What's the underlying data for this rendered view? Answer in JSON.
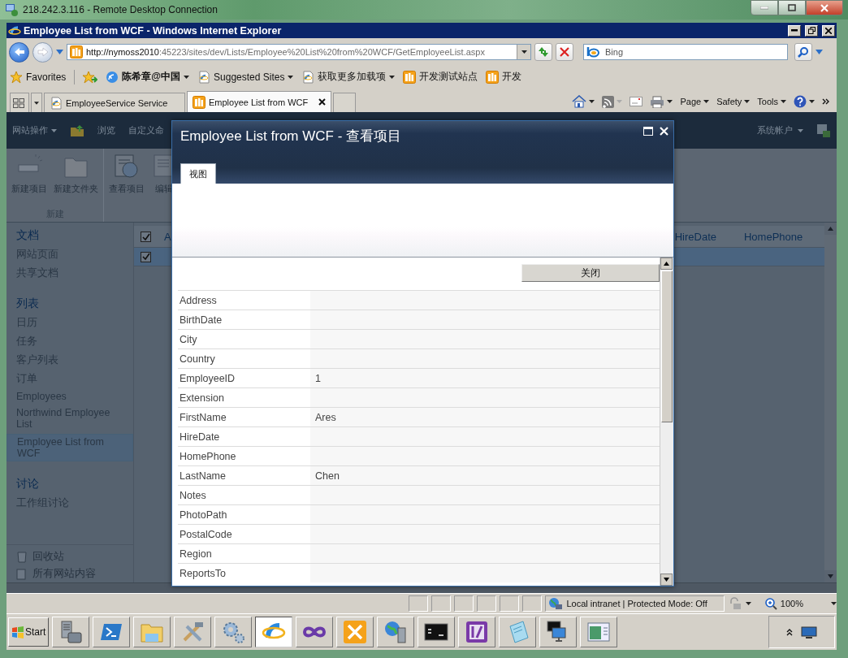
{
  "rdp_window": {
    "title": "218.242.3.116 - Remote Desktop Connection"
  },
  "browser": {
    "title": "Employee List from WCF - Windows Internet Explorer",
    "address": {
      "host": "http://nymoss2010",
      "rest": ":45223/sites/dev/Lists/Employee%20List%20from%20WCF/GetEmployeeList.aspx"
    },
    "search": {
      "placeholder": "Bing"
    },
    "favorites": {
      "label": "Favorites",
      "items": [
        {
          "label": "陈希章@中国",
          "kind": "feed",
          "menu": true
        },
        {
          "label": "Suggested Sites",
          "kind": "page",
          "menu": true
        },
        {
          "label": "获取更多加载项",
          "kind": "page",
          "menu": true
        },
        {
          "label": "开发测试站点",
          "kind": "site",
          "menu": false
        },
        {
          "label": "开发",
          "kind": "site",
          "menu": false
        }
      ]
    },
    "tabs": [
      {
        "label": "EmployeeService Service",
        "kind": "page",
        "selected": false
      },
      {
        "label": "Employee List from WCF",
        "kind": "site",
        "selected": true
      }
    ],
    "commands": [
      {
        "label": "Page"
      },
      {
        "label": "Safety"
      },
      {
        "label": "Tools"
      }
    ]
  },
  "sharepoint": {
    "top_nav": [
      {
        "label": "网站操作",
        "menu": true
      },
      {
        "label": "浏览",
        "menu": false
      },
      {
        "label": "自定义命",
        "menu": false
      }
    ],
    "account": "系统帐户",
    "ribbon": {
      "buttons": [
        {
          "label": "新建项目",
          "kind": "new-item"
        },
        {
          "label": "新建文件夹",
          "kind": "new-folder"
        },
        {
          "label": "查看项目",
          "kind": "view-item"
        },
        {
          "label": "编辑",
          "kind": "edit-item"
        }
      ],
      "group": "新建"
    },
    "quick_launch": [
      {
        "heading": "文档",
        "items": [
          {
            "label": "网站页面",
            "selected": false
          },
          {
            "label": "共享文档",
            "selected": false
          }
        ]
      },
      {
        "heading": "列表",
        "items": [
          {
            "label": "日历",
            "selected": false
          },
          {
            "label": "任务",
            "selected": false
          },
          {
            "label": "客户列表",
            "selected": false
          },
          {
            "label": "订单",
            "selected": false
          },
          {
            "label": "Employees",
            "selected": false
          },
          {
            "label": "Northwind Employee List",
            "selected": false
          },
          {
            "label": "Employee List from WCF",
            "selected": true
          }
        ]
      },
      {
        "heading": "讨论",
        "items": [
          {
            "label": "工作组讨论",
            "selected": false
          }
        ]
      }
    ],
    "footer_links": [
      {
        "label": "回收站",
        "kind": "recycle"
      },
      {
        "label": "所有网站内容",
        "kind": "content"
      }
    ],
    "grid": {
      "select_all": {
        "checked": true
      },
      "columns": [
        "A",
        "HireDate",
        "HomePhone"
      ],
      "rows": [
        {
          "checked": true,
          "selected": true
        }
      ]
    }
  },
  "dialog": {
    "title": "Employee List from WCF - 查看项目",
    "tabs": [
      {
        "label": "视图",
        "selected": true
      }
    ],
    "close_button": "关闭",
    "fields": [
      {
        "label": "Address"
      },
      {
        "label": "BirthDate"
      },
      {
        "label": "City"
      },
      {
        "label": "Country"
      },
      {
        "label": "EmployeeID",
        "value": "1"
      },
      {
        "label": "Extension"
      },
      {
        "label": "FirstName",
        "value": "Ares"
      },
      {
        "label": "HireDate"
      },
      {
        "label": "HomePhone"
      },
      {
        "label": "LastName",
        "value": "Chen"
      },
      {
        "label": "Notes"
      },
      {
        "label": "PhotoPath"
      },
      {
        "label": "PostalCode"
      },
      {
        "label": "Region"
      },
      {
        "label": "ReportsTo"
      }
    ]
  },
  "status_bar": {
    "zone": "Local intranet | Protected Mode: Off",
    "zoom": "100%"
  },
  "taskbar": {
    "start": "Start",
    "buttons": [
      {
        "kind": "server",
        "active": false
      },
      {
        "kind": "shell",
        "active": false
      },
      {
        "kind": "folder",
        "active": false
      },
      {
        "kind": "tools",
        "active": false
      },
      {
        "kind": "gears",
        "active": false
      },
      {
        "kind": "browser",
        "active": true
      },
      {
        "kind": "infinity",
        "active": false
      },
      {
        "kind": "wrench",
        "active": false
      },
      {
        "kind": "globe",
        "active": false
      },
      {
        "kind": "console",
        "active": false
      },
      {
        "kind": "purple",
        "active": false
      },
      {
        "kind": "notepad",
        "active": false
      },
      {
        "kind": "monitor",
        "active": false
      },
      {
        "kind": "window",
        "active": false
      }
    ]
  }
}
